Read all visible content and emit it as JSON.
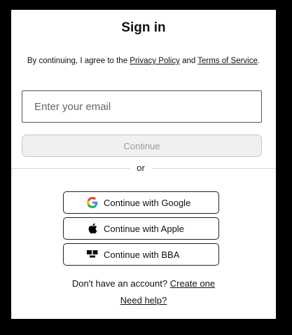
{
  "title": "Sign in",
  "consent": {
    "prefix": "By continuing, I agree to the ",
    "privacy_link": "Privacy Policy",
    "middle": " and ",
    "terms_link": "Terms of Service",
    "suffix": "."
  },
  "email": {
    "placeholder": "Enter your email",
    "value": ""
  },
  "continue_label": "Continue",
  "divider_text": "or",
  "social": [
    {
      "label": "Continue with Google",
      "icon": "google-icon"
    },
    {
      "label": "Continue with Apple",
      "icon": "apple-icon"
    },
    {
      "label": "Continue with BBA",
      "icon": "bba-icon"
    }
  ],
  "signup": {
    "prompt": "Don't have an account? ",
    "link": "Create one"
  },
  "help_link": "Need help?",
  "colors": {
    "background": "#ffffff",
    "outer_frame": "#000000",
    "disabled_button_bg": "#f0f0f0",
    "disabled_button_text": "#9c9c9c"
  }
}
